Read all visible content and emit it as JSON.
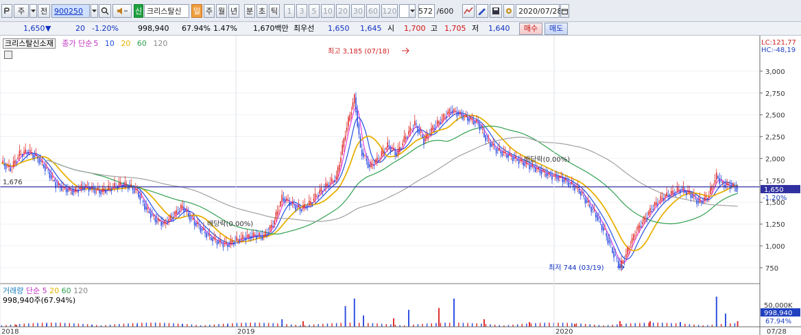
{
  "toolbar": {
    "period": "주",
    "prev": "전",
    "code": "900250",
    "badge": "신",
    "name": "크리스탈신",
    "tab_day": "일",
    "tab_week": "주",
    "tab_month": "월",
    "tab_year": "년",
    "tab_min": "분",
    "tab_sec": "초",
    "tab_tick": "틱",
    "intervals": [
      "1",
      "3",
      "5",
      "10",
      "20",
      "30",
      "60",
      "120"
    ],
    "count": "572",
    "total": "/600",
    "date": "2020/07/28"
  },
  "quote": {
    "price": "1,650",
    "change": "20",
    "change_pct": "-1.20%",
    "volume": "998,940",
    "volume_pct": "67.94%",
    "turnover": "1.47%",
    "amount": "1,670백만",
    "best_label": "최우선",
    "ask": "1,650",
    "bid": "1,645",
    "open_label": "시",
    "open": "1,700",
    "high_label": "고",
    "high": "1,705",
    "low_label": "저",
    "low": "1,640",
    "buy": "매수",
    "sell": "매도"
  },
  "legend": {
    "name": "크리스탈신소재",
    "ma_label": "종가 단순",
    "ma": [
      "5",
      "10",
      "20",
      "60",
      "120"
    ],
    "vol_name": "거래량",
    "vol_ma_label": "단순",
    "vol_ma": [
      "5",
      "20",
      "60",
      "120"
    ],
    "vol_value": "998,940주(67.94%)"
  },
  "colors": {
    "ma5": "#e040e0",
    "ma10": "#2050e0",
    "ma20": "#e8b000",
    "ma60": "#30a050",
    "ma120": "#a0a0a0",
    "candle_up": "#e03030",
    "candle_down": "#3050e0",
    "hline": "#3030a0"
  },
  "chart_data": {
    "type": "candlestick",
    "x_labels": [
      "2018",
      "2019",
      "2020",
      "07/28"
    ],
    "y_ticks": [
      "750",
      "1,000",
      "1,250",
      "1,500",
      "1,750",
      "2,000",
      "2,250",
      "2,500",
      "2,750",
      "3,000"
    ],
    "ylim": [
      600,
      3250
    ],
    "lc": "LC:121,77",
    "hc": "HC:-48,19",
    "current_price": "1,650",
    "current_change": "-1,20%",
    "hline_value": "1,676",
    "max_annotation": "최고 3,185 (07/18)",
    "min_annotation": "최저 744 (03/19)",
    "event_labels": [
      "배당락(0.00%)",
      "배당락(0.00%)"
    ],
    "volume_ticks": [
      "50,000K"
    ],
    "volume_value": "998,940",
    "volume_pct": "67.94%",
    "price_series": [
      [
        0,
        1950
      ],
      [
        6,
        1880
      ],
      [
        12,
        2050
      ],
      [
        18,
        2080
      ],
      [
        24,
        2000
      ],
      [
        30,
        1870
      ],
      [
        36,
        1700
      ],
      [
        42,
        1650
      ],
      [
        48,
        1620
      ],
      [
        54,
        1680
      ],
      [
        60,
        1650
      ],
      [
        66,
        1620
      ],
      [
        72,
        1660
      ],
      [
        78,
        1700
      ],
      [
        84,
        1690
      ],
      [
        90,
        1620
      ],
      [
        96,
        1420
      ],
      [
        102,
        1300
      ],
      [
        108,
        1250
      ],
      [
        114,
        1350
      ],
      [
        120,
        1450
      ],
      [
        126,
        1300
      ],
      [
        132,
        1200
      ],
      [
        138,
        1100
      ],
      [
        144,
        1040
      ],
      [
        150,
        1010
      ],
      [
        156,
        1070
      ],
      [
        162,
        1100
      ],
      [
        168,
        1120
      ],
      [
        174,
        1110
      ],
      [
        180,
        1250
      ],
      [
        186,
        1550
      ],
      [
        192,
        1480
      ],
      [
        198,
        1420
      ],
      [
        204,
        1480
      ],
      [
        210,
        1600
      ],
      [
        216,
        1700
      ],
      [
        222,
        1780
      ],
      [
        228,
        2300
      ],
      [
        234,
        2700
      ],
      [
        238,
        2100
      ],
      [
        244,
        1900
      ],
      [
        250,
        2000
      ],
      [
        256,
        2150
      ],
      [
        262,
        2050
      ],
      [
        268,
        2250
      ],
      [
        274,
        2400
      ],
      [
        280,
        2200
      ],
      [
        286,
        2350
      ],
      [
        292,
        2450
      ],
      [
        298,
        2550
      ],
      [
        304,
        2500
      ],
      [
        310,
        2450
      ],
      [
        316,
        2400
      ],
      [
        322,
        2200
      ],
      [
        328,
        2100
      ],
      [
        334,
        2050
      ],
      [
        340,
        2000
      ],
      [
        346,
        1950
      ],
      [
        352,
        1900
      ],
      [
        358,
        1850
      ],
      [
        364,
        1800
      ],
      [
        370,
        1780
      ],
      [
        376,
        1720
      ],
      [
        382,
        1650
      ],
      [
        388,
        1500
      ],
      [
        394,
        1350
      ],
      [
        400,
        1150
      ],
      [
        406,
        900
      ],
      [
        410,
        760
      ],
      [
        414,
        900
      ],
      [
        420,
        1150
      ],
      [
        426,
        1300
      ],
      [
        432,
        1450
      ],
      [
        438,
        1550
      ],
      [
        444,
        1600
      ],
      [
        450,
        1650
      ],
      [
        456,
        1600
      ],
      [
        462,
        1500
      ],
      [
        468,
        1550
      ],
      [
        474,
        1800
      ],
      [
        478,
        1700
      ],
      [
        484,
        1690
      ],
      [
        488,
        1650
      ]
    ],
    "volume_series": [
      [
        10,
        2
      ],
      [
        30,
        3
      ],
      [
        60,
        2
      ],
      [
        90,
        2
      ],
      [
        120,
        3
      ],
      [
        150,
        2
      ],
      [
        186,
        8
      ],
      [
        200,
        6
      ],
      [
        228,
        22
      ],
      [
        234,
        30
      ],
      [
        240,
        12
      ],
      [
        260,
        9
      ],
      [
        270,
        18
      ],
      [
        290,
        20
      ],
      [
        300,
        30
      ],
      [
        320,
        8
      ],
      [
        350,
        5
      ],
      [
        380,
        3
      ],
      [
        410,
        6
      ],
      [
        430,
        6
      ],
      [
        450,
        5
      ],
      [
        474,
        32
      ],
      [
        480,
        14
      ],
      [
        488,
        6
      ]
    ]
  }
}
